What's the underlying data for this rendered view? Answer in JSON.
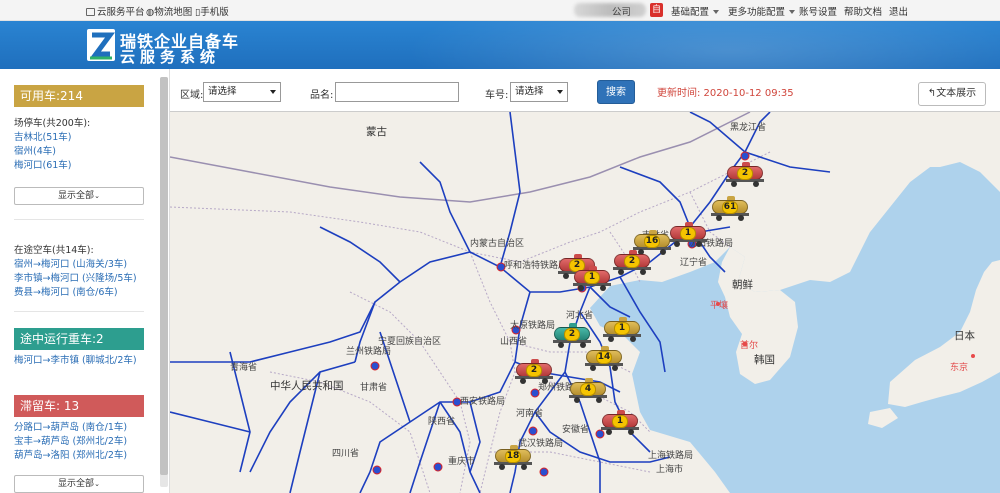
{
  "topbar": {
    "cloud_platform": "云服务平台",
    "logistics_map": "物流地图",
    "mobile": "手机版",
    "company": "公司",
    "badge": "自",
    "basic_config": "基础配置",
    "more_config": "更多功能配置",
    "account": "账号设置",
    "help": "帮助文档",
    "logout": "退出"
  },
  "brand": {
    "line1": "瑞铁企业自备车",
    "line2": "云服务系统"
  },
  "sidebar": {
    "available": {
      "header": "可用车:214",
      "yard_title": "场停车(共200车):",
      "yard_items": [
        "吉林北(51车)",
        "宿州(4车)",
        "梅河口(61车)"
      ],
      "show_all": "显示全部",
      "empty_title": "在途空车(共14车):",
      "empty_items": [
        "宿州→梅河口 (山海关/3车)",
        "李市镇→梅河口 (兴隆场/5车)",
        "费县→梅河口 (南仓/6车)"
      ]
    },
    "loaded": {
      "header": "途中运行重车:2",
      "items": [
        "梅河口→李市镇 (聊城北/2车)"
      ]
    },
    "stuck": {
      "header": "滞留车:  13",
      "items": [
        "分路口→葫芦岛 (南仓/1车)",
        "宝丰→葫芦岛 (郑州北/2车)",
        "葫芦岛→洛阳 (郑州北/2车)"
      ],
      "show_all": "显示全部"
    }
  },
  "filters": {
    "region_label": "区域:",
    "region_value": "请选择",
    "product_label": "品名:",
    "product_value": "",
    "car_label": "车号:",
    "car_value": "请选择",
    "search": "搜索",
    "updated": "更新时间: 2020-10-12 09:35",
    "text_view": "文本展示"
  },
  "map": {
    "labels": {
      "mongolia": "蒙古",
      "heilongjiang": "黑龙江省",
      "inner_mongolia": "内蒙古自治区",
      "jilin": "吉林省",
      "hebei": "河北省",
      "liaoning": "辽宁省",
      "shenyang_rail": "沈阳铁路局",
      "north_korea": "朝鲜",
      "pyongyang": "平壤",
      "seoul": "首尔",
      "south_korea": "韩国",
      "japan": "日本",
      "tokyo": "东京",
      "hohhot_rail": "呼和浩特铁路局",
      "ningxia": "宁夏回族自治区",
      "shanxi": "山西省",
      "taiyuan_rail": "太原铁路局",
      "qinghai": "青海省",
      "lanzhou_rail": "兰州铁路局",
      "gansu": "甘肃省",
      "china": "中华人民共和国",
      "shaanxi": "陕西省",
      "henan": "河南省",
      "zhengzhou_rail": "郑州铁路局",
      "anhui": "安徽省",
      "shanghai_rail": "上海铁路局",
      "shanghai": "上海市",
      "sichuan": "四川省",
      "chongqing": "重庆市",
      "chengdu_rail": "成都铁路局",
      "xian_rail": "西安铁路局",
      "wuhan_rail": "武汉铁路局",
      "hubei": "湖北省",
      "jiangsu": "江苏省",
      "beijing_rail": "北京铁路局"
    },
    "trains": [
      {
        "count": "2",
        "color": "red"
      },
      {
        "count": "61",
        "color": "gold"
      },
      {
        "count": "1",
        "color": "red"
      },
      {
        "count": "16",
        "color": "gold"
      },
      {
        "count": "2",
        "color": "red"
      },
      {
        "count": "2",
        "color": "red"
      },
      {
        "count": "1",
        "color": "red"
      },
      {
        "count": "1",
        "color": "gold"
      },
      {
        "count": "2",
        "color": "teal"
      },
      {
        "count": "14",
        "color": "gold"
      },
      {
        "count": "2",
        "color": "red"
      },
      {
        "count": "4",
        "color": "gold"
      },
      {
        "count": "1",
        "color": "red"
      },
      {
        "count": "18",
        "color": "gold"
      }
    ]
  },
  "colors": {
    "available": "#c9a443",
    "loaded": "#2d9e8f",
    "stuck": "#d05a5a",
    "header_blue": "#2079c7",
    "link": "#2a6db5"
  }
}
